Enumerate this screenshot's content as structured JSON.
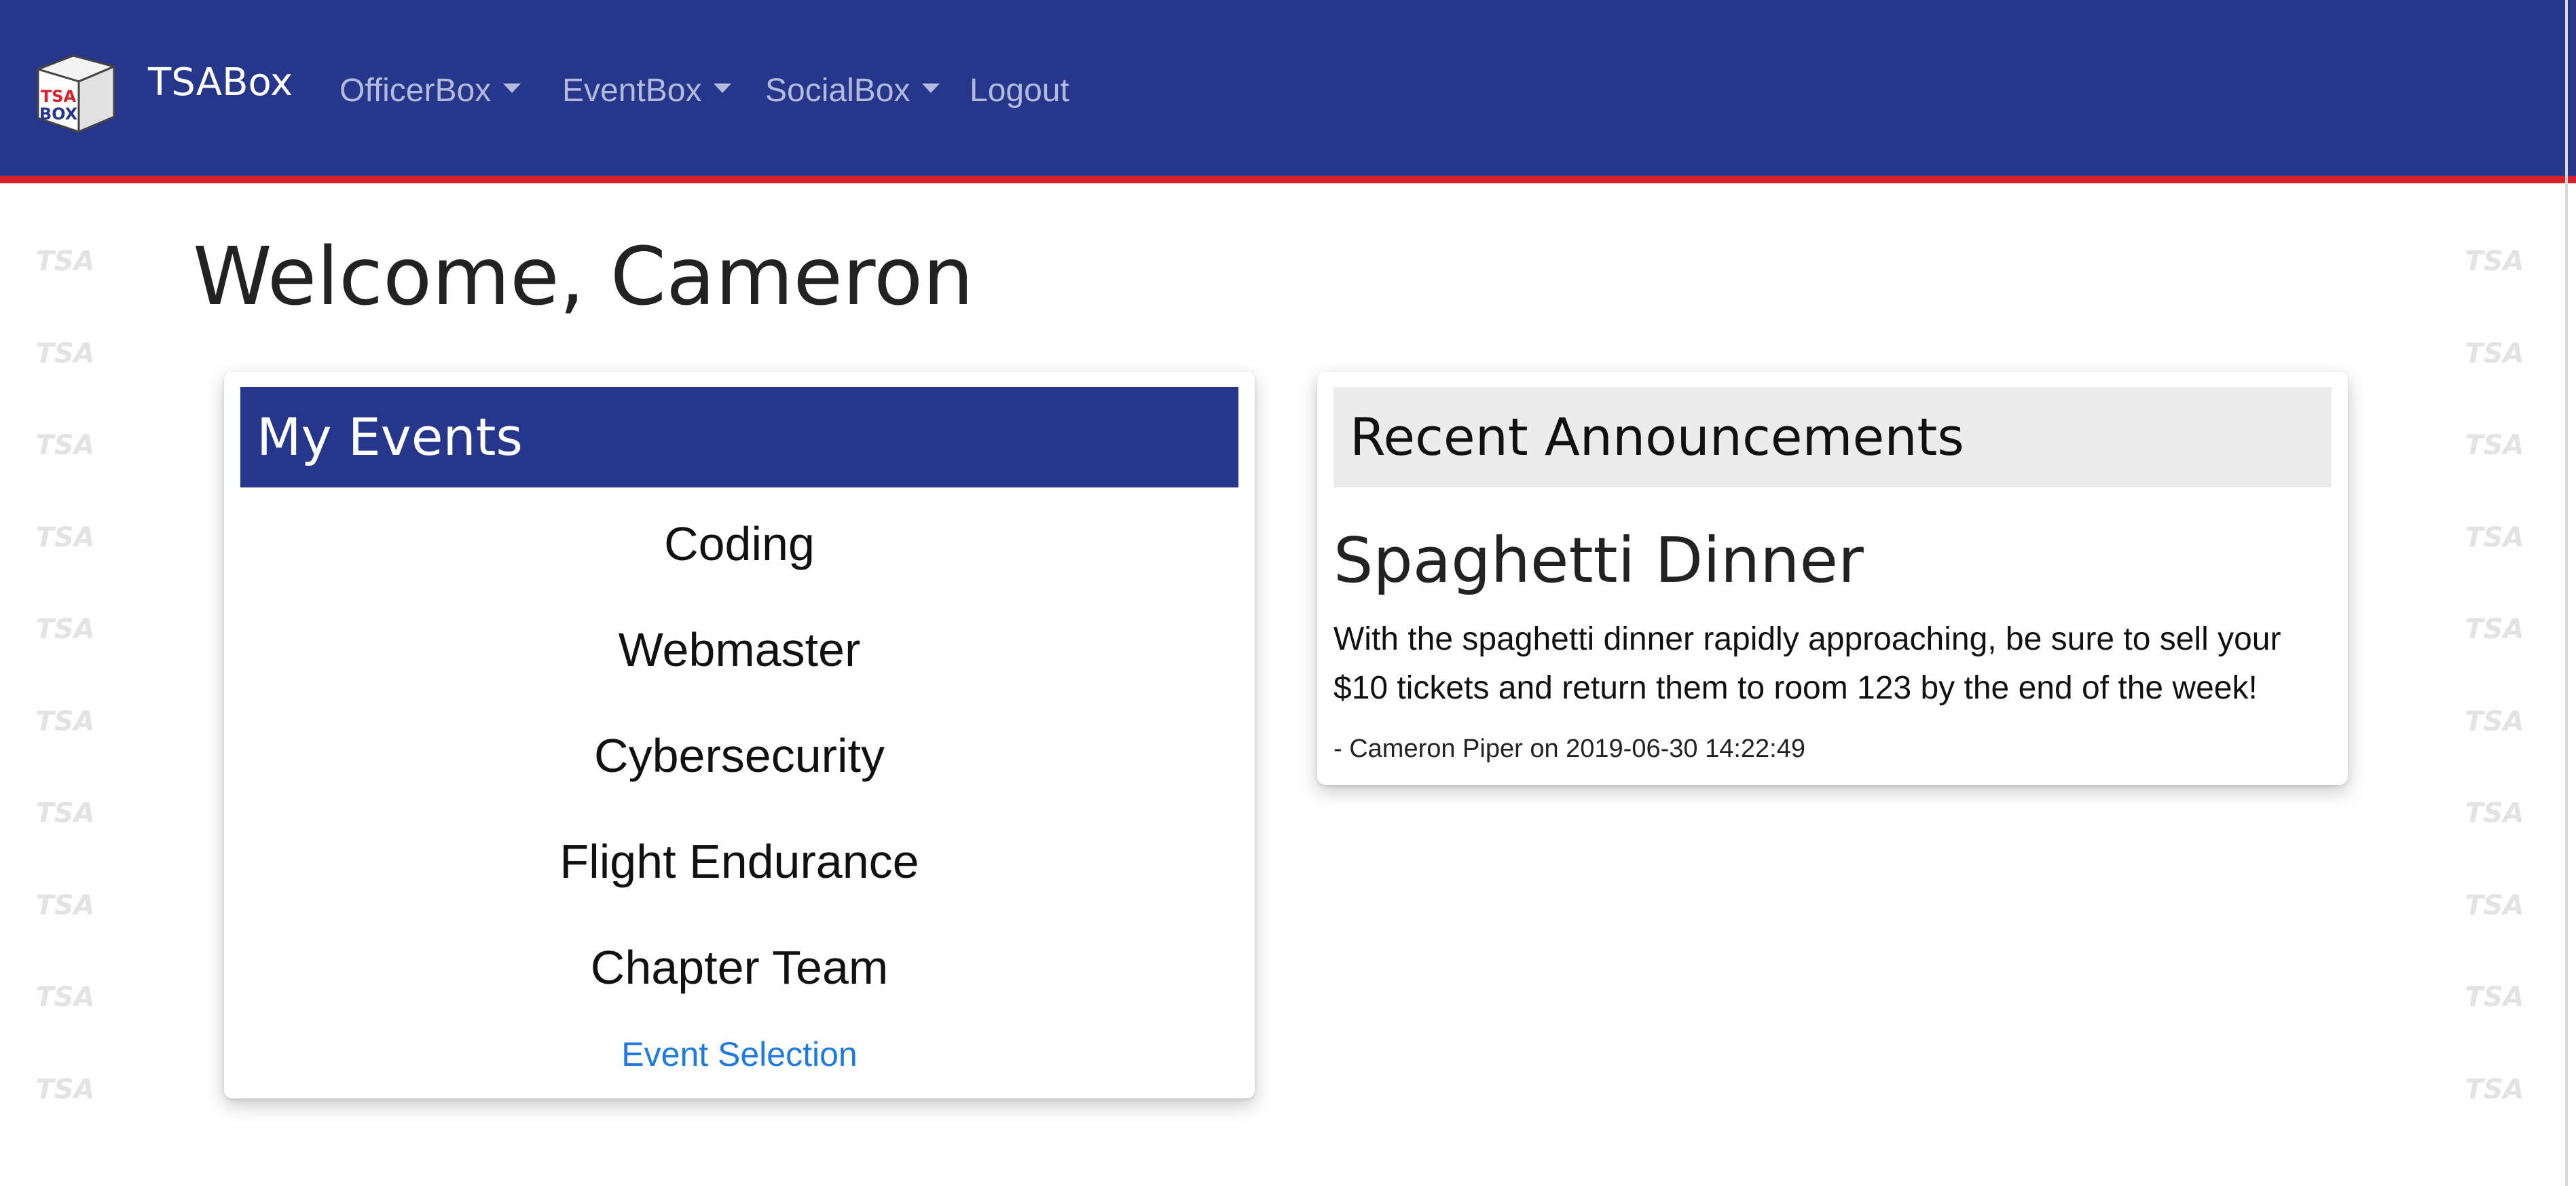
{
  "navbar": {
    "brand_name": "TSABox",
    "logo_text_top": "TSA",
    "logo_text_bottom": "BOX",
    "items": [
      {
        "label": "OfficerBox",
        "dropdown": true
      },
      {
        "label": "EventBox",
        "dropdown": true
      },
      {
        "label": "SocialBox",
        "dropdown": true
      },
      {
        "label": "Logout",
        "dropdown": false
      }
    ]
  },
  "welcome": "Welcome, Cameron",
  "my_events": {
    "title": "My Events",
    "events": [
      "Coding",
      "Webmaster",
      "Cybersecurity",
      "Flight Endurance",
      "Chapter Team"
    ],
    "link_label": "Event Selection"
  },
  "announcements": {
    "title": "Recent Announcements",
    "items": [
      {
        "title": "Spaghetti Dinner",
        "body": "With the spaghetti dinner rapidly approaching, be sure to sell your $10 tickets and return them to room 123 by the end of the week!",
        "meta": "- Cameron Piper on 2019-06-30 14:22:49"
      }
    ]
  },
  "watermark_text": "TSA",
  "colors": {
    "navbar_bg": "#26368a",
    "navbar_accent": "#d6202b",
    "link": "#1f7ae0",
    "announcement_header_bg": "#ececec"
  }
}
